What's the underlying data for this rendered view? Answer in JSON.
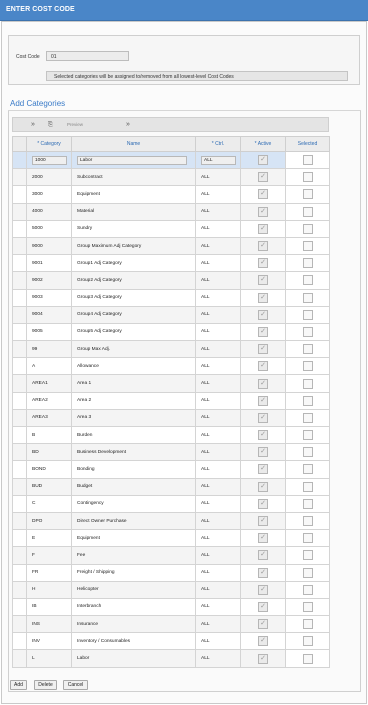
{
  "window": {
    "title": "ENTER COST CODE"
  },
  "header": {
    "cost_code_label": "Cost Code",
    "cost_code_value": "01",
    "info_text": "Selected categories will be assigned to/removed from  all lowest-level Cost Codes"
  },
  "section": {
    "title": "Add Categories"
  },
  "toolbar": {
    "expand_icon": "»",
    "export_icon": "⎘",
    "preview_label": "Preview",
    "next_icon": "»"
  },
  "grid": {
    "columns": [
      "* Category",
      "Name",
      "* Ctrl.",
      "* Active",
      "Selected"
    ],
    "rows": [
      {
        "category": "1000",
        "name": "Labor",
        "ctrl": "ALL",
        "active": true,
        "selected": false
      },
      {
        "category": "2000",
        "name": "Subcontract",
        "ctrl": "ALL",
        "active": true,
        "selected": false
      },
      {
        "category": "3000",
        "name": "Equipment",
        "ctrl": "ALL",
        "active": true,
        "selected": false
      },
      {
        "category": "4000",
        "name": "Material",
        "ctrl": "ALL",
        "active": true,
        "selected": false
      },
      {
        "category": "5000",
        "name": "Sundry",
        "ctrl": "ALL",
        "active": true,
        "selected": false
      },
      {
        "category": "9000",
        "name": "Group Maximum Adj Category",
        "ctrl": "ALL",
        "active": true,
        "selected": false
      },
      {
        "category": "9001",
        "name": "Group1 Adj Category",
        "ctrl": "ALL",
        "active": true,
        "selected": false
      },
      {
        "category": "9002",
        "name": "Group2 Adj Category",
        "ctrl": "ALL",
        "active": true,
        "selected": false
      },
      {
        "category": "9003",
        "name": "Group3 Adj Category",
        "ctrl": "ALL",
        "active": true,
        "selected": false
      },
      {
        "category": "9004",
        "name": "Group4 Adj Category",
        "ctrl": "ALL",
        "active": true,
        "selected": false
      },
      {
        "category": "9005",
        "name": "Group5 Adj Category",
        "ctrl": "ALL",
        "active": true,
        "selected": false
      },
      {
        "category": "99",
        "name": "Group Max Adj.",
        "ctrl": "ALL",
        "active": true,
        "selected": false
      },
      {
        "category": "A",
        "name": "Allowance",
        "ctrl": "ALL",
        "active": true,
        "selected": false
      },
      {
        "category": "AREA1",
        "name": "Area 1",
        "ctrl": "ALL",
        "active": true,
        "selected": false
      },
      {
        "category": "AREA2",
        "name": "Area 2",
        "ctrl": "ALL",
        "active": true,
        "selected": false
      },
      {
        "category": "AREA3",
        "name": "Area 3",
        "ctrl": "ALL",
        "active": true,
        "selected": false
      },
      {
        "category": "B",
        "name": "Burden",
        "ctrl": "ALL",
        "active": true,
        "selected": false
      },
      {
        "category": "BD",
        "name": "Business Development",
        "ctrl": "ALL",
        "active": true,
        "selected": false
      },
      {
        "category": "BOND",
        "name": "Bonding",
        "ctrl": "ALL",
        "active": true,
        "selected": false
      },
      {
        "category": "BUD",
        "name": "Budget",
        "ctrl": "ALL",
        "active": true,
        "selected": false
      },
      {
        "category": "C",
        "name": "Contingency",
        "ctrl": "ALL",
        "active": true,
        "selected": false
      },
      {
        "category": "DPO",
        "name": "Direct Owner Purchase",
        "ctrl": "ALL",
        "active": true,
        "selected": false
      },
      {
        "category": "E",
        "name": "Equipment",
        "ctrl": "ALL",
        "active": true,
        "selected": false
      },
      {
        "category": "F",
        "name": "Fee",
        "ctrl": "ALL",
        "active": true,
        "selected": false
      },
      {
        "category": "FR",
        "name": "Freight / Shipping",
        "ctrl": "ALL",
        "active": true,
        "selected": false
      },
      {
        "category": "H",
        "name": "Helicopter",
        "ctrl": "ALL",
        "active": true,
        "selected": false
      },
      {
        "category": "IB",
        "name": "Interbranch",
        "ctrl": "ALL",
        "active": true,
        "selected": false
      },
      {
        "category": "INS",
        "name": "Insurance",
        "ctrl": "ALL",
        "active": true,
        "selected": false
      },
      {
        "category": "INV",
        "name": "Inventory / Consumables",
        "ctrl": "ALL",
        "active": true,
        "selected": false
      },
      {
        "category": "L",
        "name": "Labor",
        "ctrl": "ALL",
        "active": true,
        "selected": false
      }
    ]
  },
  "buttons": {
    "add": "Add",
    "delete": "Delete",
    "cancel": "Cancel"
  },
  "colors": {
    "titlebar": "#4a86c8",
    "accent": "#3a7bc8",
    "selected_row": "#d6e4f5"
  }
}
